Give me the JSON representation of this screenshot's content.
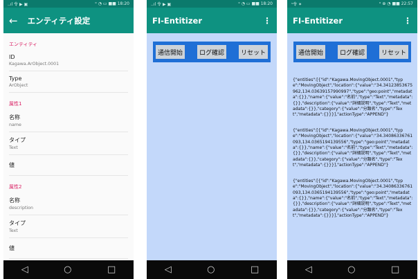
{
  "screens": {
    "settings": {
      "status": {
        "left": "..ıl 令 ▶ ▣",
        "right": "ᵒ ◔ ▭ ■■ 18:20"
      },
      "title": "エンティティ設定",
      "sections": [
        {
          "header": "エンティティ",
          "items": [
            {
              "title": "ID",
              "sub": "Kagawa.ArObject.0001"
            },
            {
              "title": "Type",
              "sub": "ArObject"
            }
          ]
        },
        {
          "header": "属性1",
          "items": [
            {
              "title": "名称",
              "sub": "name"
            },
            {
              "title": "タイプ",
              "sub": "Text"
            },
            {
              "title": "値",
              "sub": ""
            }
          ]
        },
        {
          "header": "属性2",
          "items": [
            {
              "title": "名称",
              "sub": "description"
            },
            {
              "title": "タイプ",
              "sub": "Text"
            },
            {
              "title": "値",
              "sub": ""
            }
          ]
        }
      ]
    },
    "main_empty": {
      "status": {
        "left": "..ıl 令 ▶ ▣",
        "right": "ᵒ ◔ ▭ ■■ 18:20"
      },
      "title": "FI-Entitizer",
      "buttons": [
        "通信開始",
        "ログ確認",
        "リセット"
      ]
    },
    "main_log": {
      "status": {
        "left": "ˢ令 ✶",
        "right": "ᵒ ⊕ ◔ ■■ 22:57"
      },
      "title": "FI-Entitizer",
      "buttons": [
        "通信開始",
        "ログ確認",
        "リセット"
      ],
      "log_entries": [
        "{\"entities\":[{\"id\":\"Kagawa.MovingObject.0001\",\"type\":\"MovingObject\",\"location\":{\"value\":\"34.34123853675962,134.03639157990997\",\"type\":\"geo:point\",\"metadata\":{}},\"name\":{\"value\":\"名前\",\"type\":\"Text\",\"metadata\":{}},\"description\":{\"value\":\"詳細説明\",\"type\":\"Text\",\"metadata\":{}},\"category\":{\"value\":\"分類名\",\"type\":\"Text\",\"metadata\":{}}}],\"actionType\":\"APPEND\"}",
        "{\"entities\":[{\"id\":\"Kagawa.MovingObject.0001\",\"type\":\"MovingObject\",\"location\":{\"value\":\"34.34086336761093,134.0365194139556\",\"type\":\"geo:point\",\"metadata\":{}},\"name\":{\"value\":\"名前\",\"type\":\"Text\",\"metadata\":{}},\"description\":{\"value\":\"詳細説明\",\"type\":\"Text\",\"metadata\":{}},\"category\":{\"value\":\"分類名\",\"type\":\"Text\",\"metadata\":{}}}],\"actionType\":\"APPEND\"}",
        "{\"entities\":[{\"id\":\"Kagawa.MovingObject.0001\",\"type\":\"MovingObject\",\"location\":{\"value\":\"34.34086336761093,134.0365194139556\",\"type\":\"geo:point\",\"metadata\":{}},\"name\":{\"value\":\"名前\",\"type\":\"Text\",\"metadata\":{}},\"description\":{\"value\":\"詳細説明\",\"type\":\"Text\",\"metadata\":{}},\"category\":{\"value\":\"分類名\",\"type\":\"Text\",\"metadata\":{}}}],\"actionType\":\"APPEND\"}"
      ]
    }
  },
  "navbar": {
    "back": "◁",
    "home": "○",
    "recents": "□"
  },
  "icons": {
    "back": "arrow-left-icon",
    "menu": "more-vert-icon"
  },
  "colors": {
    "appbar": "#0e9281",
    "statusbar": "#0b7a6c",
    "accent": "#d81b60",
    "panel_bg": "#c3d8fa",
    "button_bar": "#1f6fd6"
  }
}
